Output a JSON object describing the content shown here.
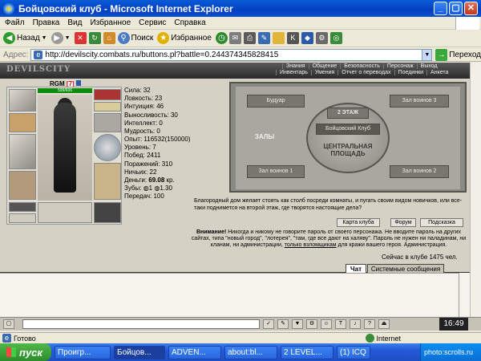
{
  "window": {
    "title": "Бойцовский клуб - Microsoft Internet Explorer"
  },
  "menu": [
    "Файл",
    "Правка",
    "Вид",
    "Избранное",
    "Сервис",
    "Справка"
  ],
  "toolbar": {
    "back": "Назад",
    "search": "Поиск",
    "favorites": "Избранное"
  },
  "address": {
    "label": "Адрес:",
    "url": "http://devilscity.combats.ru/buttons.pl?battle=0.244374345828415",
    "go": "Переход"
  },
  "game": {
    "logo": "DEVILSCITY",
    "nav_top": [
      "Знания",
      "Общение",
      "Безопасность",
      "Персонаж",
      "Выход"
    ],
    "nav_bottom": [
      "Инвентарь",
      "Умения",
      "Отчет о переводах",
      "Поединки",
      "Анкета"
    ],
    "character": {
      "name": "RGM",
      "level": "[7]",
      "hp": "599/606"
    },
    "stats": [
      "Сила: 32",
      "Ловкость: 23",
      "Интуиция: 46",
      "Выносливость: 30",
      "Интеллект: 0",
      "Мудрость: 0"
    ],
    "stats2": [
      "Опыт: 116532(150000)",
      "Уровень: 7",
      "Побед: 2411",
      "Поражений: 310",
      "Ничьих: 22"
    ],
    "money_label": "Деньги:",
    "money_value": "69.08",
    "money_unit": " кр.",
    "stats3": [
      "Зубы: ◍1 ◍1.30",
      "Передач: 100"
    ],
    "map_labels": {
      "boudoir": "Будуар",
      "hall1": "Зал воинов 1",
      "hall2": "Зал воинов 2",
      "hall3": "Зал воинов 3",
      "floor2": "2 ЭТАЖ",
      "club": "Бойцовский Клуб",
      "halls": "ЗАЛЫ",
      "central": "ЦЕНТРАЛЬНАЯ ПЛОЩАДЬ"
    },
    "map_description": "Благородный дом желает стоять как столб посреди комнаты, и пугать своим видом новичков, или все-таки поднимется на второй этаж, где творятся настоящие дела?",
    "buttons": [
      "Карта клуба",
      "Форум",
      "Подсказка"
    ],
    "notice_bold": "Внимание!",
    "notice_text": " Никогда и никому не говорите пароль от своего персонажа. Не вводите пароль на других сайтах, типа \"новый город\", \"лотерея\", \"там, где все дают на халяву\". Пароль не нужен ни паладинам, ни кланам, ни администрации,",
    "notice_link": "только взломщикам",
    "notice_tail": " для кражи вашего героя. Администрация.",
    "online": "Сейчас в клубе 1475 чел."
  },
  "chat": {
    "tabs": [
      "Чат",
      "Системные сообщения"
    ],
    "clock": "16:49"
  },
  "status": {
    "left": "Готово",
    "zone": "Internet"
  },
  "taskbar": {
    "start": "пуск",
    "tasks": [
      "Проигр...",
      "Бойцов...",
      "ADVEN...",
      "about:bl...",
      "2 LEVEL...",
      "(1) ICQ"
    ],
    "tray": "photo:scrolls.ru"
  }
}
